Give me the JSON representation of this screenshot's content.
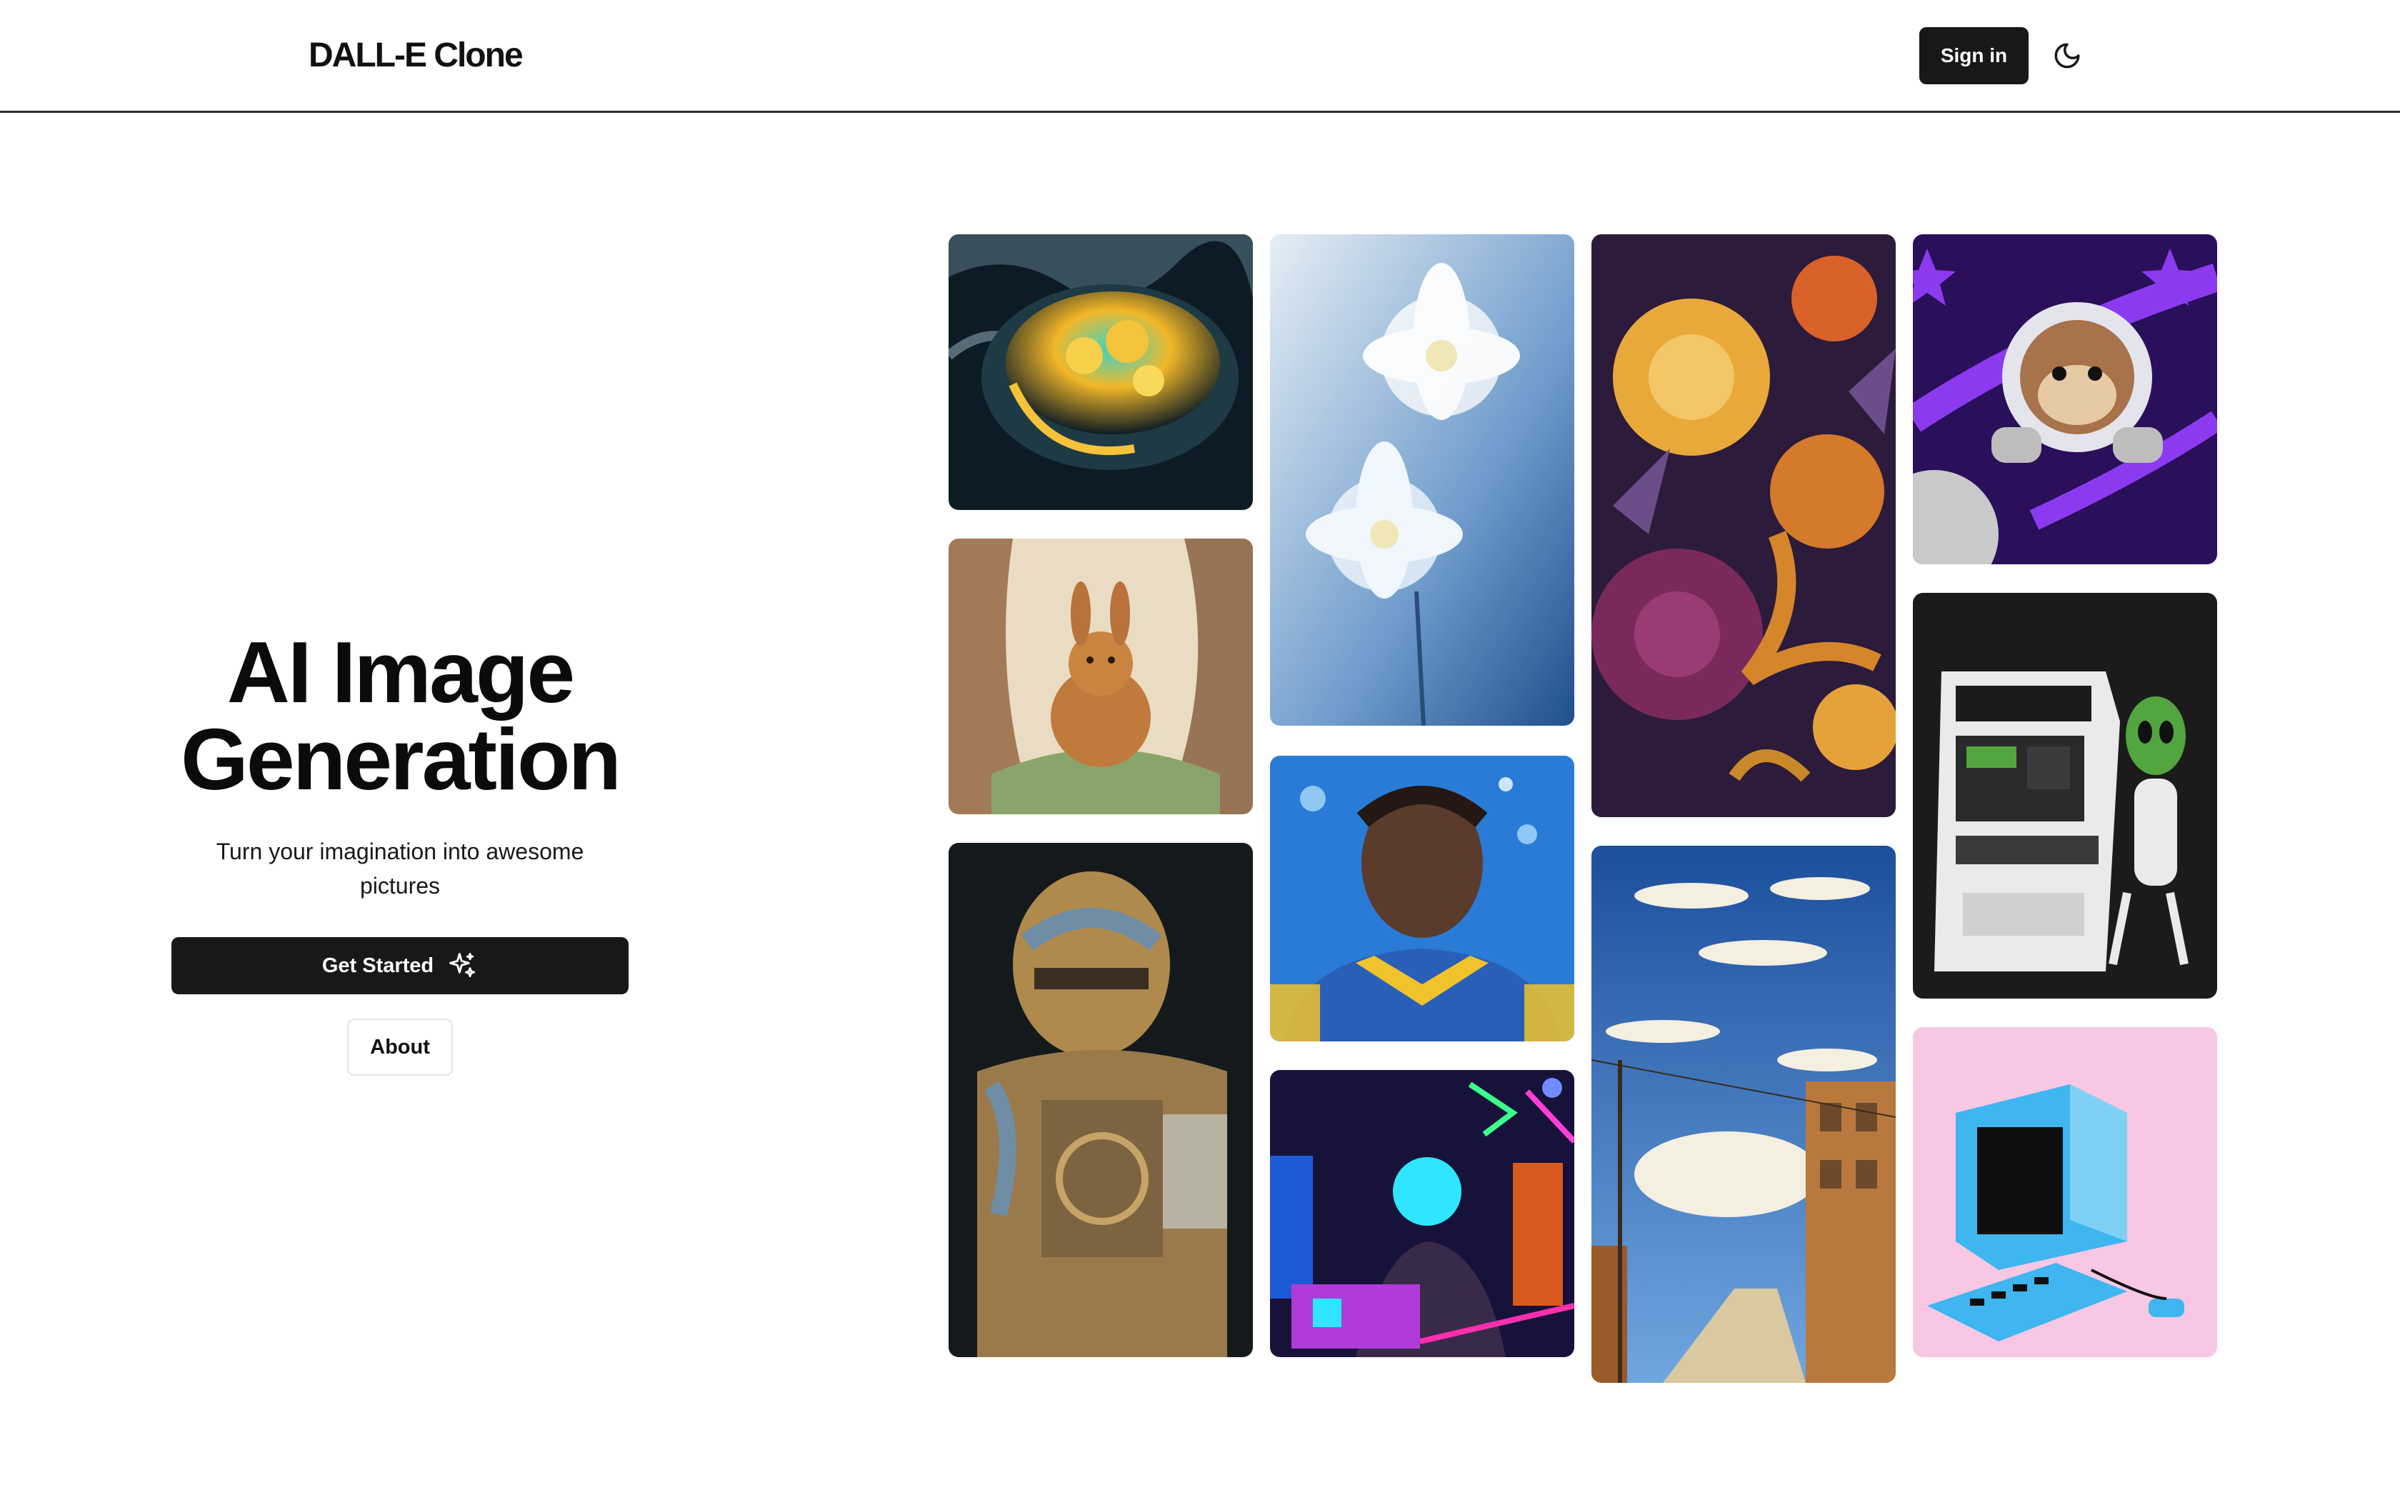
{
  "header": {
    "brand": "DALL-E Clone",
    "sign_in_label": "Sign in",
    "theme_icon": "moon-icon"
  },
  "hero": {
    "title_line1": "AI Image",
    "title_line2": "Generation",
    "subtitle_line1": "Turn your imagination into awesome",
    "subtitle_line2": "pictures",
    "get_started_label": "Get Started",
    "get_started_icon": "sparkles-icon",
    "about_label": "About"
  },
  "gallery": {
    "images": [
      {
        "id": "soup-bowl",
        "column": 1,
        "subject": "glowing soup bowl with clouds",
        "colors": [
          "#0d1c24",
          "#f2b728",
          "#2fc5c0"
        ]
      },
      {
        "id": "bunny",
        "column": 1,
        "subject": "watercolor bunny",
        "colors": [
          "#e9dcc2",
          "#b9733a",
          "#8aa56b"
        ]
      },
      {
        "id": "robot",
        "column": 1,
        "subject": "rusty robot",
        "colors": [
          "#141a1c",
          "#b08a4c",
          "#6f8ea6"
        ]
      },
      {
        "id": "white-flowers",
        "column": 2,
        "subject": "white flowers on blue",
        "colors": [
          "#dbe7f0",
          "#2f67a8",
          "#ffffff"
        ]
      },
      {
        "id": "football-player",
        "column": 2,
        "subject": "football player portrait",
        "colors": [
          "#2a7bd6",
          "#f0c22b",
          "#5a3b2c"
        ]
      },
      {
        "id": "neon-dj",
        "column": 2,
        "subject": "neon DJ",
        "colors": [
          "#17123a",
          "#b13bd9",
          "#2ee6ff"
        ]
      },
      {
        "id": "chrysanthemums",
        "column": 3,
        "subject": "chrysanthemums",
        "colors": [
          "#2c1b3a",
          "#e9a93a",
          "#7a2a5a"
        ]
      },
      {
        "id": "street-sky",
        "column": 3,
        "subject": "sunny street and clouds",
        "colors": [
          "#2d6fc0",
          "#f4efe0",
          "#b9793e"
        ]
      },
      {
        "id": "space-monkey",
        "column": 4,
        "subject": "monkey astronaut",
        "colors": [
          "#2a0f5a",
          "#8c3af0",
          "#c9c9c9"
        ]
      },
      {
        "id": "alien-arcade",
        "column": 4,
        "subject": "alien playing arcade",
        "colors": [
          "#1b1b1b",
          "#eaeaea",
          "#52a53f"
        ]
      },
      {
        "id": "retro-computer",
        "column": 4,
        "subject": "retro computer",
        "colors": [
          "#f7c7e4",
          "#3fb6ef",
          "#0f0f10"
        ]
      }
    ]
  }
}
